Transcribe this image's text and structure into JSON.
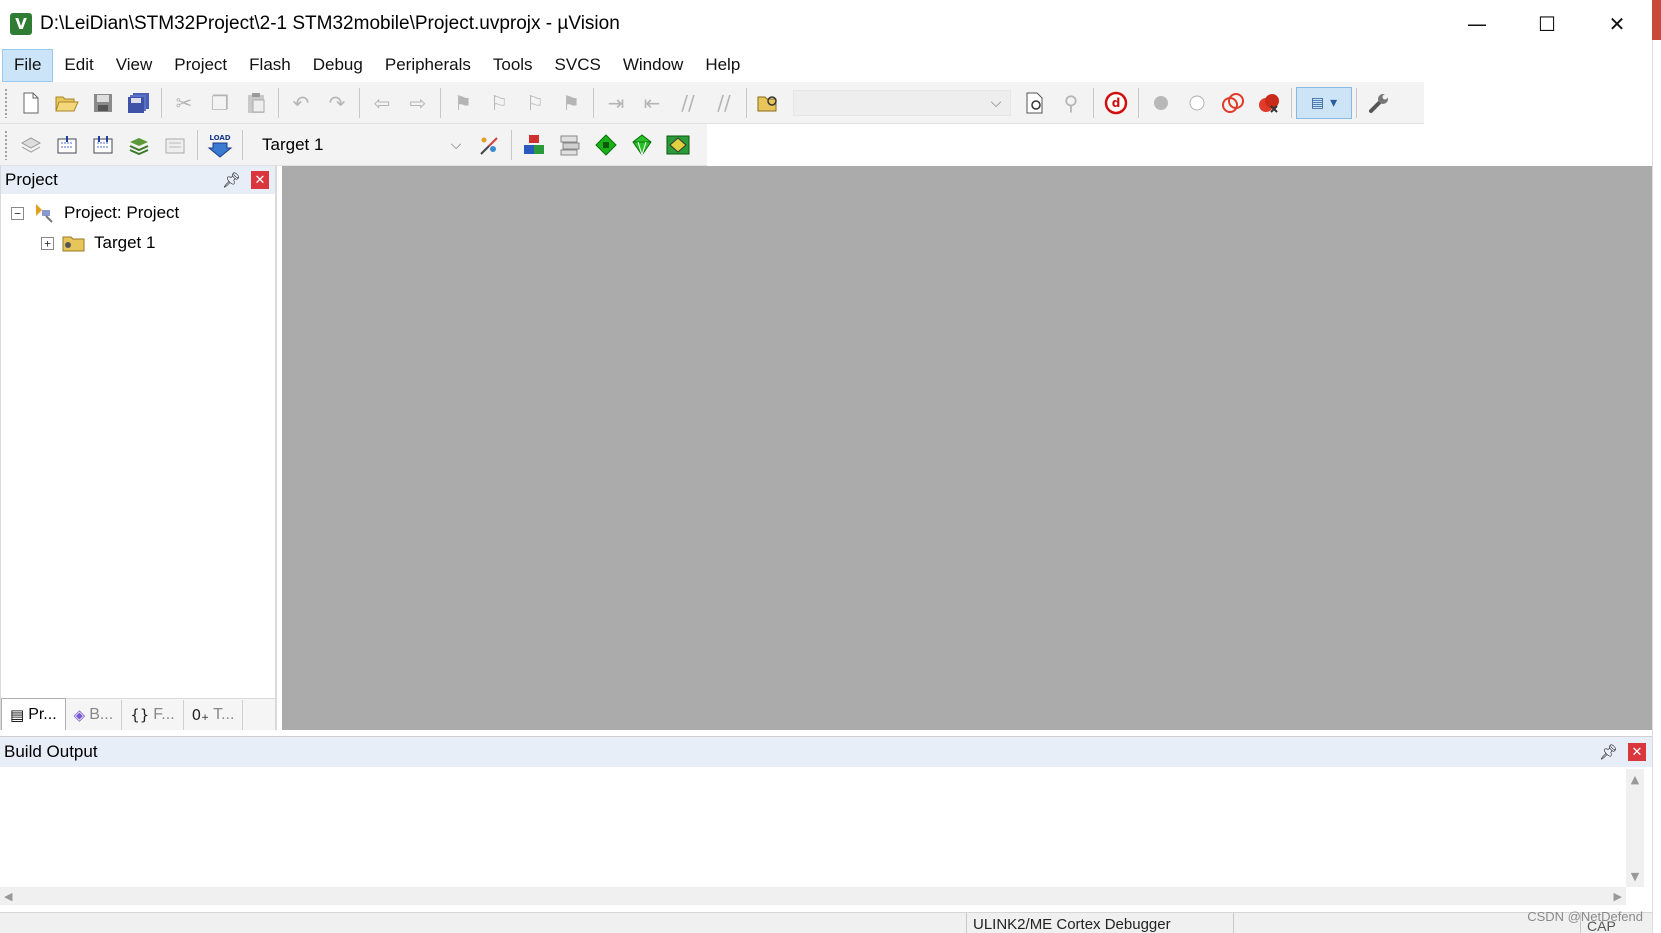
{
  "window": {
    "title": "D:\\LeiDian\\STM32Project\\2-1 STM32mobile\\Project.uvprojx - µVision",
    "app_icon_glyph": "V",
    "controls": {
      "minimize": "—",
      "maximize": "☐",
      "close": "✕"
    }
  },
  "menu": [
    "File",
    "Edit",
    "View",
    "Project",
    "Flash",
    "Debug",
    "Peripherals",
    "Tools",
    "SVCS",
    "Window",
    "Help"
  ],
  "menu_active": "File",
  "toolbar": {
    "find_combo_value": "",
    "target_combo_value": "Target 1",
    "load_label": "LOAD"
  },
  "project_pane": {
    "title": "Project",
    "tree": [
      {
        "label": "Project: Project",
        "expander": "−",
        "icon": "project-icon"
      },
      {
        "label": "Target 1",
        "expander": "+",
        "icon": "folder-icon"
      }
    ],
    "tabs": [
      {
        "label": "Pr...",
        "icon": "project-tab-icon",
        "active": true
      },
      {
        "label": "B...",
        "icon": "books-icon",
        "active": false
      },
      {
        "label": "F...",
        "icon": "functions-icon",
        "active": false
      },
      {
        "label": "T...",
        "icon": "templates-icon",
        "active": false
      }
    ]
  },
  "build_output": {
    "title": "Build Output",
    "content": ""
  },
  "status": {
    "debugger": "ULINK2/ME Cortex Debugger",
    "cap": "CAP",
    "watermark": "CSDN @NetDefend"
  },
  "colors": {
    "editor_bg": "#ababab",
    "pane_header_bg": "#e7eef7",
    "close_red": "#d9363e",
    "active_menu_bg": "#cce4f7"
  }
}
